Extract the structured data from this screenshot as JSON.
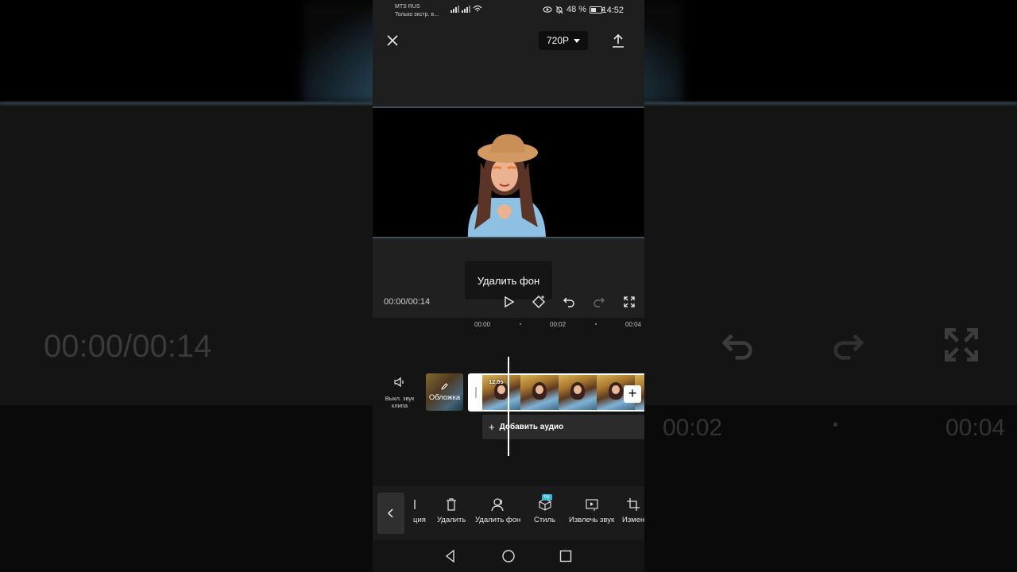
{
  "background": {
    "time": "00:00/00:14",
    "ruler": [
      "00:02",
      "00:04"
    ]
  },
  "status_bar": {
    "carrier_line1": "MTS RUS",
    "carrier_line2": "Только экстр. в...",
    "battery": "48 %",
    "time": "14:52"
  },
  "top_bar": {
    "resolution": "720P"
  },
  "tooltip": "Удалить фон",
  "player": {
    "timecode": "00:00/00:14"
  },
  "timeline": {
    "ruler": [
      "00:00",
      "00:02",
      "00:04"
    ],
    "mute_label": "Выкл. звук клипа",
    "cover_label": "Обложка",
    "clip_duration": "12.5s",
    "add_audio": "Добавить аудио"
  },
  "toolbar": {
    "items": [
      {
        "label": "ция",
        "icon": "partial-icon"
      },
      {
        "label": "Удалить",
        "icon": "trash-icon"
      },
      {
        "label": "Удалить фон",
        "icon": "remove-background-icon"
      },
      {
        "label": "Стиль",
        "icon": "cube-icon",
        "badge": "try"
      },
      {
        "label": "Извлечь звук",
        "icon": "extract-audio-icon"
      },
      {
        "label": "Измен",
        "icon": "crop-icon"
      }
    ]
  },
  "colors": {
    "accent": "#38b6d8",
    "panel": "#1c1c1c",
    "preview_border": "#3d4f59"
  }
}
